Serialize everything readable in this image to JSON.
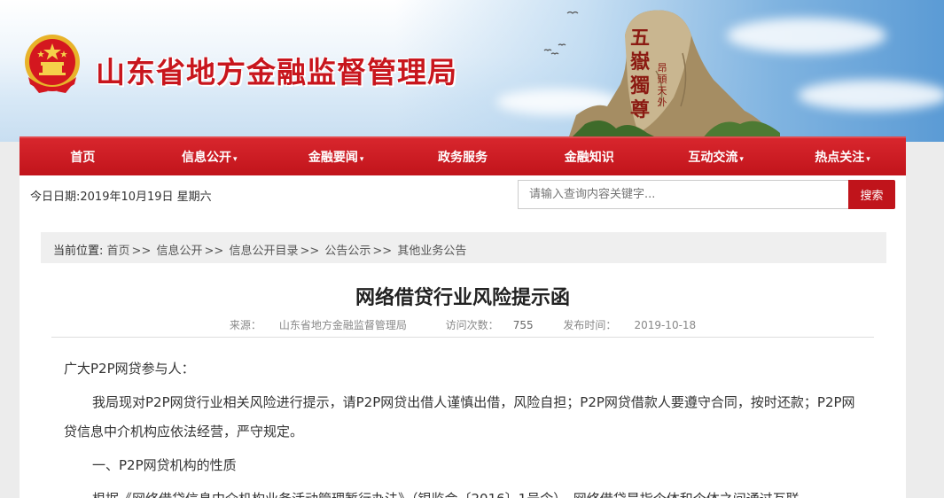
{
  "header": {
    "site_title": "山东省地方金融监督管理局",
    "rock_text": [
      "五",
      "嶽",
      "獨",
      "尊"
    ],
    "rock_subtext": "昂頭天外"
  },
  "nav": {
    "items": [
      {
        "label": "首页",
        "dropdown": false
      },
      {
        "label": "信息公开",
        "dropdown": true
      },
      {
        "label": "金融要闻",
        "dropdown": true
      },
      {
        "label": "政务服务",
        "dropdown": false
      },
      {
        "label": "金融知识",
        "dropdown": false
      },
      {
        "label": "互动交流",
        "dropdown": true
      },
      {
        "label": "热点关注",
        "dropdown": true
      }
    ]
  },
  "toolbar": {
    "date_text": "今日日期:2019年10月19日 星期六",
    "search_placeholder": "请输入查询内容关键字...",
    "search_button": "搜索"
  },
  "breadcrumb": {
    "label": "当前位置:",
    "items": [
      "首页",
      "信息公开",
      "信息公开目录",
      "公告公示",
      "其他业务公告"
    ],
    "separator": ">>"
  },
  "article": {
    "title": "网络借贷行业风险提示函",
    "source_label": "来源：",
    "source_value": "山东省地方金融监督管理局",
    "views_label": "访问次数：",
    "views_value": "755",
    "date_label": "发布时间：",
    "date_value": "2019-10-18",
    "paragraphs": [
      "广大P2P网贷参与人：",
      "我局现对P2P网贷行业相关风险进行提示，请P2P网贷出借人谨慎出借，风险自担；P2P网贷借款人要遵守合同，按时还款；P2P网贷信息中介机构应依法经营，严守规定。",
      "一、P2P网贷机构的性质",
      "根据《网络借贷信息中介机构业务活动管理暂行办法》（银监会〔2016〕1号令），网络借贷是指个体和个体之间通过互联"
    ]
  },
  "colors": {
    "brand_red": "#c8161d",
    "nav_red": "#c1141b",
    "page_bg": "#ececec"
  }
}
